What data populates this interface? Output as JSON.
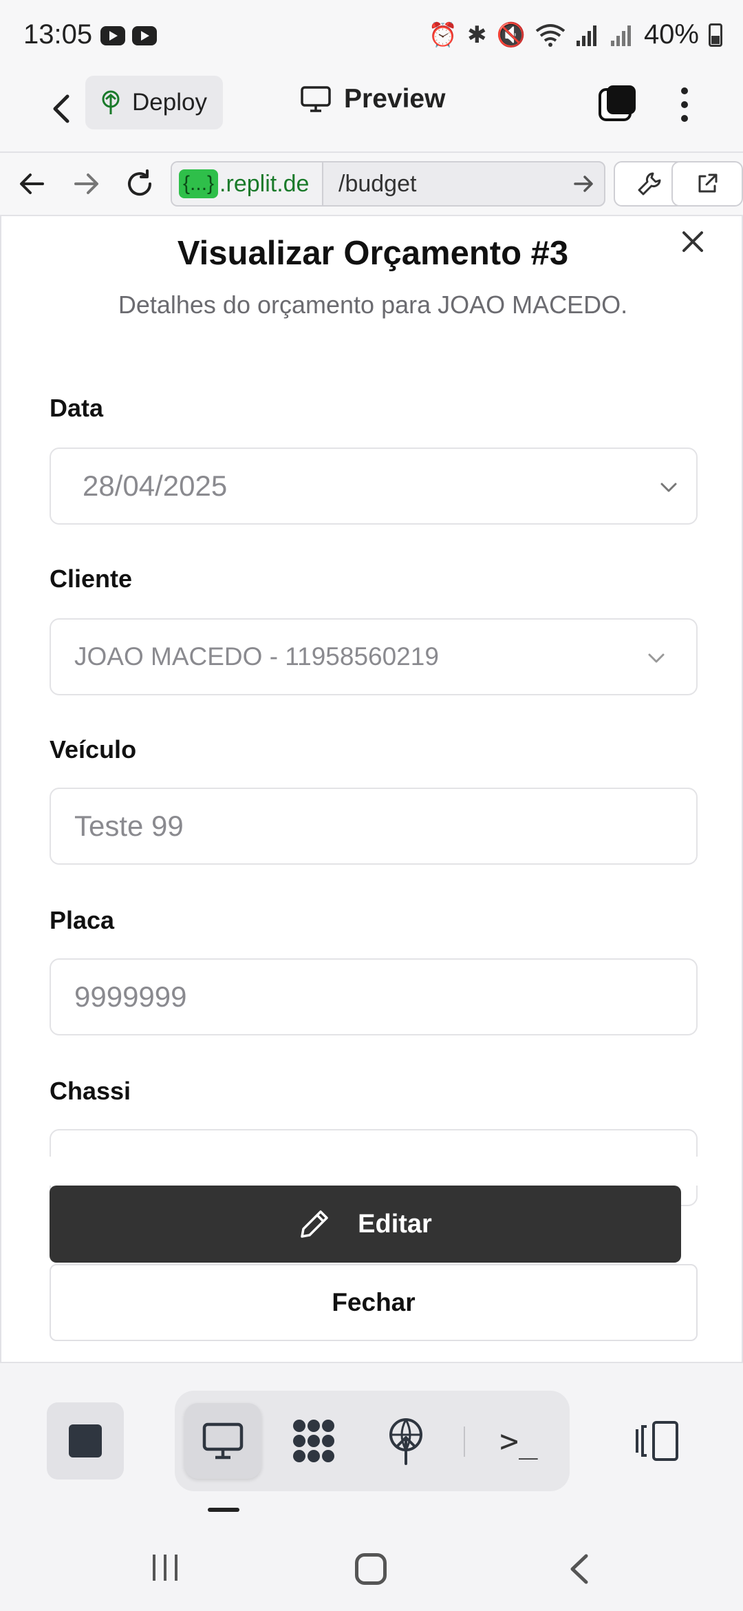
{
  "status_bar": {
    "time": "13:05",
    "battery": "40%"
  },
  "app_header": {
    "deploy_label": "Deploy",
    "preview_label": "Preview"
  },
  "browser": {
    "url_chip": "{...}",
    "url_host": ".replit.de",
    "url_path": "/budget"
  },
  "modal": {
    "title": "Visualizar Orçamento #3",
    "subtitle": "Detalhes do orçamento para JOAO MACEDO.",
    "fields": {
      "data": {
        "label": "Data",
        "value": "28/04/2025"
      },
      "cliente": {
        "label": "Cliente",
        "value": "JOAO MACEDO - 11958560219"
      },
      "veiculo": {
        "label": "Veículo",
        "value": "Teste 99"
      },
      "placa": {
        "label": "Placa",
        "value": "9999999"
      },
      "chassi": {
        "label": "Chassi",
        "value": ""
      }
    },
    "edit_label": "Editar",
    "close_label": "Fechar"
  },
  "toolbar": {
    "icons": [
      "stop-icon",
      "desktop-icon",
      "cluster-icon",
      "deploy-icon",
      "terminal-icon",
      "split-view-icon"
    ],
    "terminal_glyph": ">_"
  },
  "colors": {
    "primary_button": "#333333",
    "url_chip": "#2fbf4a",
    "url_host_text": "#1a7a2a"
  }
}
